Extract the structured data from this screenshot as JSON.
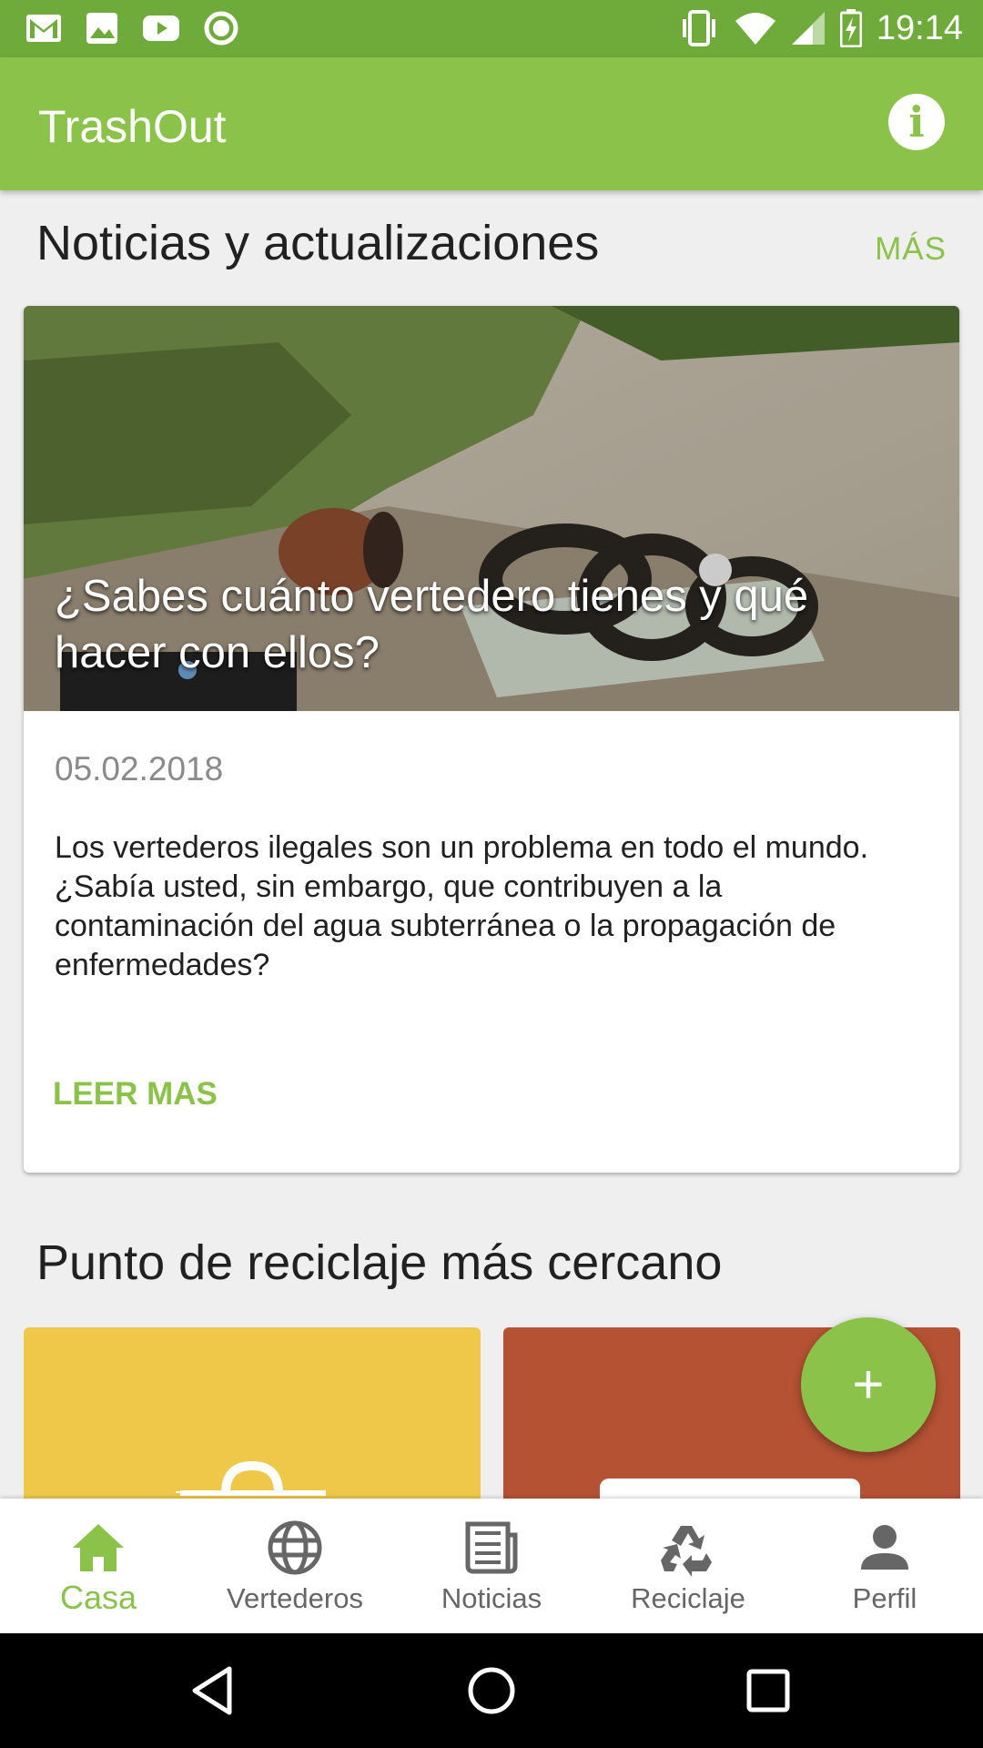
{
  "status_bar": {
    "time": "19:14"
  },
  "app_bar": {
    "title": "TrashOut",
    "info_icon": "info-icon"
  },
  "news_section": {
    "title": "Noticias y actualizaciones",
    "more_label": "MÁS",
    "card": {
      "headline": "¿Sabes cuánto vertedero tienes y qué hacer con ellos?",
      "date": "05.02.2018",
      "body": "Los vertederos ilegales son un problema en todo el mundo. ¿Sabía usted, sin embargo, que contribuyen a la contaminación del agua subterránea o la propagación de enfermedades?",
      "read_more": "LEER MAS"
    }
  },
  "recycling_section": {
    "title": "Punto de reciclaje más cercano"
  },
  "fab": {
    "icon": "plus-icon",
    "label": "+"
  },
  "bottom_nav": {
    "items": [
      {
        "label": "Casa",
        "icon": "home-icon",
        "active": true
      },
      {
        "label": "Vertederos",
        "icon": "globe-icon",
        "active": false
      },
      {
        "label": "Noticias",
        "icon": "newspaper-icon",
        "active": false
      },
      {
        "label": "Reciclaje",
        "icon": "recycle-icon",
        "active": false
      },
      {
        "label": "Perfil",
        "icon": "person-icon",
        "active": false
      }
    ]
  },
  "colors": {
    "primary": "#8bc34a",
    "status_bar": "#6fab3a",
    "yellow_card": "#efc84a",
    "orange_card": "#b55233"
  }
}
